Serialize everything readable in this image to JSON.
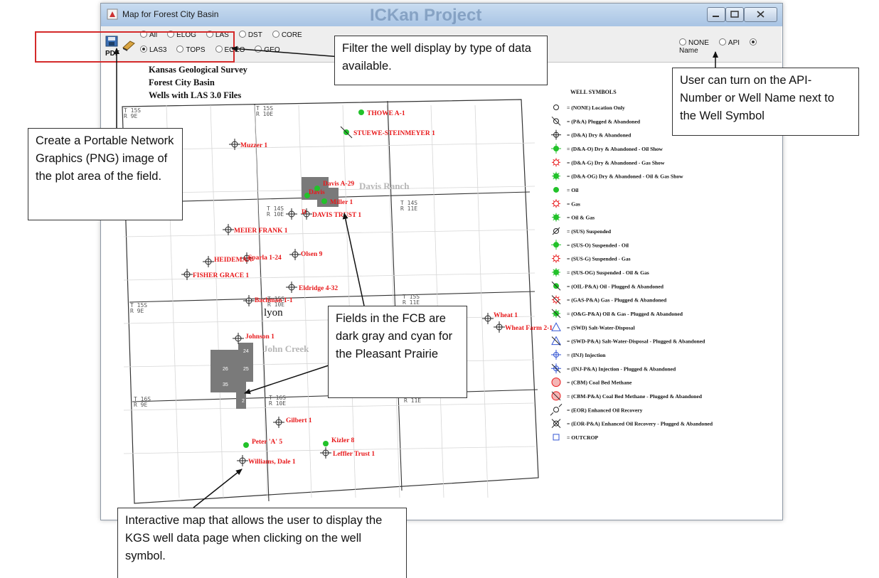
{
  "window": {
    "title": "Map for Forest City Basin",
    "watermark": "ICKan Project"
  },
  "toolbar": {
    "pdf_label": "PDF",
    "filter_row1": [
      "All",
      "ELOG",
      "LAS",
      "DST",
      "CORE"
    ],
    "filter_row2": [
      "LAS3",
      "TOPS",
      "EGEO",
      "GEO"
    ],
    "selected_filter": "LAS3",
    "label_options": [
      "NONE",
      "API",
      "Name"
    ],
    "selected_label": "Name"
  },
  "map": {
    "header_line1": "Kansas Geological Survey",
    "header_line2": "Forest City Basin",
    "header_line3": "Wells with LAS 3.0 Files",
    "county_label": "lyon",
    "field_names": [
      "Davis Ranch",
      "John Creek"
    ],
    "section_labels": [
      "26",
      "25",
      "24",
      "35",
      "2"
    ],
    "township_labels": [
      "T 15S R 9E",
      "T 15S R 10E",
      "T 14S R 10E",
      "T 14S R 11E",
      "T 15S R 9E",
      "T 15S R 10E",
      "T 15S R 11E",
      "T 16S R 9E",
      "T 16S R 10E",
      "T 16S R 11E"
    ],
    "wells": [
      {
        "name": "THOWE A-1",
        "symbol": "oil"
      },
      {
        "name": "STUEWE-STEINMEYER 1",
        "symbol": "oil-plugged"
      },
      {
        "name": "Muzzer 1",
        "symbol": "dry"
      },
      {
        "name": "Davis A-29",
        "symbol": "oil"
      },
      {
        "name": "Miller 1",
        "symbol": "oil"
      },
      {
        "name": "Davis",
        "symbol": "oil"
      },
      {
        "name": "DAVIS TRUST 1",
        "symbol": "dry"
      },
      {
        "name": "D",
        "symbol": "dry"
      },
      {
        "name": "MEIER FRANK 1",
        "symbol": "dry"
      },
      {
        "name": "Olsen 9",
        "symbol": "dry"
      },
      {
        "name": "Sparla 1-24",
        "symbol": "dry"
      },
      {
        "name": "HEIDEMAN",
        "symbol": "dry"
      },
      {
        "name": "FISHER GRACE 1",
        "symbol": "dry"
      },
      {
        "name": "Eldridge 4-32",
        "symbol": "dry"
      },
      {
        "name": "Bachman 1-1",
        "symbol": "dry"
      },
      {
        "name": "Wheat 1",
        "symbol": "dry"
      },
      {
        "name": "Wheat Farm 2-1",
        "symbol": "dry"
      },
      {
        "name": "Johnson 1",
        "symbol": "dry"
      },
      {
        "name": "Gilbert 1",
        "symbol": "dry"
      },
      {
        "name": "Peter 'A' 5",
        "symbol": "oil"
      },
      {
        "name": "Kizler 8",
        "symbol": "oil"
      },
      {
        "name": "Leffler Trust 1",
        "symbol": "dry"
      },
      {
        "name": "Williams, Dale 1",
        "symbol": "dry"
      }
    ]
  },
  "legend": {
    "title": "WELL SYMBOLS",
    "items": [
      {
        "label": "= (NONE) Location Only",
        "icon": "circle-icon"
      },
      {
        "label": "= (P&A) Plugged & Abandoned",
        "icon": "plugged-circle-icon"
      },
      {
        "label": "= (D&A) Dry & Abandoned",
        "icon": "dry-icon"
      },
      {
        "label": "= (D&A-O) Dry & Abandoned - Oil Show",
        "icon": "dry-oil-show-icon"
      },
      {
        "label": "= (D&A-G) Dry & Abandoned - Gas Show",
        "icon": "dry-gas-show-icon"
      },
      {
        "label": "= (D&A-OG) Dry & Abandoned - Oil & Gas Show",
        "icon": "dry-oil-gas-show-icon"
      },
      {
        "label": "= Oil",
        "icon": "oil-icon"
      },
      {
        "label": "= Gas",
        "icon": "gas-icon"
      },
      {
        "label": "= Oil & Gas",
        "icon": "oil-gas-icon"
      },
      {
        "label": "= (SUS) Suspended",
        "icon": "suspended-icon"
      },
      {
        "label": "= (SUS-O) Suspended - Oil",
        "icon": "suspended-oil-icon"
      },
      {
        "label": "= (SUS-G) Suspended - Gas",
        "icon": "suspended-gas-icon"
      },
      {
        "label": "= (SUS-OG) Suspended - Oil & Gas",
        "icon": "suspended-oil-gas-icon"
      },
      {
        "label": "= (OIL-P&A) Oil - Plugged & Abandoned",
        "icon": "oil-plugged-icon"
      },
      {
        "label": "= (GAS-P&A) Gas - Plugged & Abandoned",
        "icon": "gas-plugged-icon"
      },
      {
        "label": "= (O&G-P&A) Oil & Gas - Plugged & Abandoned",
        "icon": "oil-gas-plugged-icon"
      },
      {
        "label": "= (SWD) Salt-Water-Disposal",
        "icon": "swd-icon"
      },
      {
        "label": "= (SWD-P&A) Salt-Water-Disposal - Plugged & Abandoned",
        "icon": "swd-plugged-icon"
      },
      {
        "label": "= (INJ) Injection",
        "icon": "injection-icon"
      },
      {
        "label": "= (INJ-P&A) Injection - Plugged & Abandoned",
        "icon": "injection-plugged-icon"
      },
      {
        "label": "= (CBM) Coal Bed Methane",
        "icon": "cbm-icon"
      },
      {
        "label": "= (CBM-P&A) Coal Bed Methane - Plugged & Abandoned",
        "icon": "cbm-plugged-icon"
      },
      {
        "label": "= (EOR) Enhanced Oil Recovery",
        "icon": "eor-icon"
      },
      {
        "label": "= (EOR-P&A) Enhanced Oil Recovery - Plugged & Abandoned",
        "icon": "eor-plugged-icon"
      },
      {
        "label": "= OUTCROP",
        "icon": "outcrop-icon"
      }
    ]
  },
  "callouts": {
    "filter": "Filter the well display by type of data available.",
    "api": "User can turn on the API-Number or Well Name next to the Well Symbol",
    "png": "Create a Portable Network Graphics (PNG) image of the plot area of the field.",
    "fields": "Fields in the FCB are  dark gray and cyan for the Pleasant Prairie",
    "interactive": "Interactive map that allows the user to display the KGS well data page when clicking on the well symbol."
  },
  "colors": {
    "well_label": "#e8191b",
    "oil_green": "#22c22a",
    "field_gray": "#7a7a7a",
    "highlight_red": "#d42a2a"
  }
}
